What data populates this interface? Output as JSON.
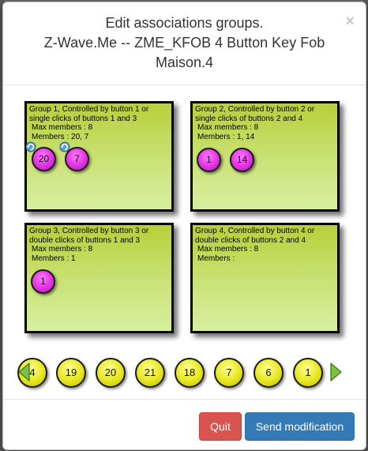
{
  "modal": {
    "title_line1": "Edit associations groups.",
    "title_line2": "Z-Wave.Me -- ZME_KFOB 4 Button Key Fob",
    "title_line3": "Maison.4",
    "close_label": "×"
  },
  "groups": [
    {
      "line1": "Group 1, Controlled by button 1 or",
      "line2": "single clicks of buttons 1 and 3",
      "max": "Max members : 8",
      "members_label": "Members : 20, 7",
      "members": [
        "20",
        "7"
      ]
    },
    {
      "line1": "Group 2, Controlled by button 2 or",
      "line2": "single clicks of buttons 2 and 4",
      "max": "Max members : 8",
      "members_label": "Members : 1, 14",
      "members": [
        "1",
        "14"
      ]
    },
    {
      "line1": "Group 3, Controlled by button 3 or",
      "line2": "double clicks of buttons 1 and 3",
      "max": "Max members : 8",
      "members_label": "Members : 1",
      "members": [
        "1"
      ]
    },
    {
      "line1": "Group 4, Controlled by button 4 or",
      "line2": "double clicks of buttons 2 and 4",
      "max": "Max members : 8",
      "members_label": "Members :",
      "members": []
    }
  ],
  "node_strip": {
    "nodes": [
      "4",
      "19",
      "20",
      "21",
      "18",
      "7",
      "6",
      "1"
    ],
    "prev_icon": "arrow-left-icon",
    "next_icon": "arrow-right-icon"
  },
  "footer": {
    "quit_label": "Quit",
    "send_label": "Send modification"
  },
  "colors": {
    "group_fill": "#cbe279",
    "member_fill": "#e83ee8",
    "node_fill": "#e6e61d",
    "quit_button": "#d9534f",
    "send_button": "#337ab7"
  }
}
